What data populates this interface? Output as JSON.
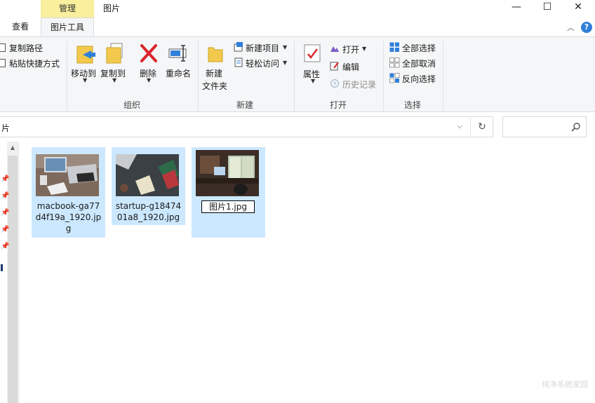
{
  "window": {
    "title": "图片",
    "context_tab_header": "管理",
    "context_tab": "图片工具",
    "view_tab": "查看",
    "minimize": "—",
    "maximize": "☐",
    "close": "✕"
  },
  "ribbon": {
    "clipboard": {
      "copy_path": "复制路径",
      "paste_shortcut": "粘贴快捷方式"
    },
    "organize": {
      "label": "组织",
      "move_to": "移动到",
      "copy_to": "复制到",
      "delete": "删除",
      "rename": "重命名"
    },
    "new": {
      "label": "新建",
      "new_folder_line1": "新建",
      "new_folder_line2": "文件夹",
      "new_item": "新建项目",
      "easy_access": "轻松访问"
    },
    "open": {
      "label": "打开",
      "properties": "属性",
      "open": "打开",
      "edit": "编辑",
      "history": "历史记录"
    },
    "select": {
      "label": "选择",
      "select_all": "全部选择",
      "select_none": "全部取消",
      "invert": "反向选择"
    }
  },
  "address": {
    "path": "片"
  },
  "files": [
    {
      "name": "macbook-ga77d4f19a_1920.jpg",
      "line1": "macbook-ga77",
      "line2": "d4f19a_1920.jp",
      "line3": "g"
    },
    {
      "name": "startup-g1847401a8_1920.jpg",
      "line1": "startup-g18474",
      "line2": "01a8_1920.jpg"
    },
    {
      "name": "图片1.jpg",
      "rename_value": "图片1.jpg"
    }
  ],
  "watermark": "纯净系统家园",
  "colors": {
    "selection": "#cce8ff",
    "context_header": "#f9ef9c",
    "ribbon_bg": "#f5f6f7",
    "delete_red": "#d9262c"
  }
}
